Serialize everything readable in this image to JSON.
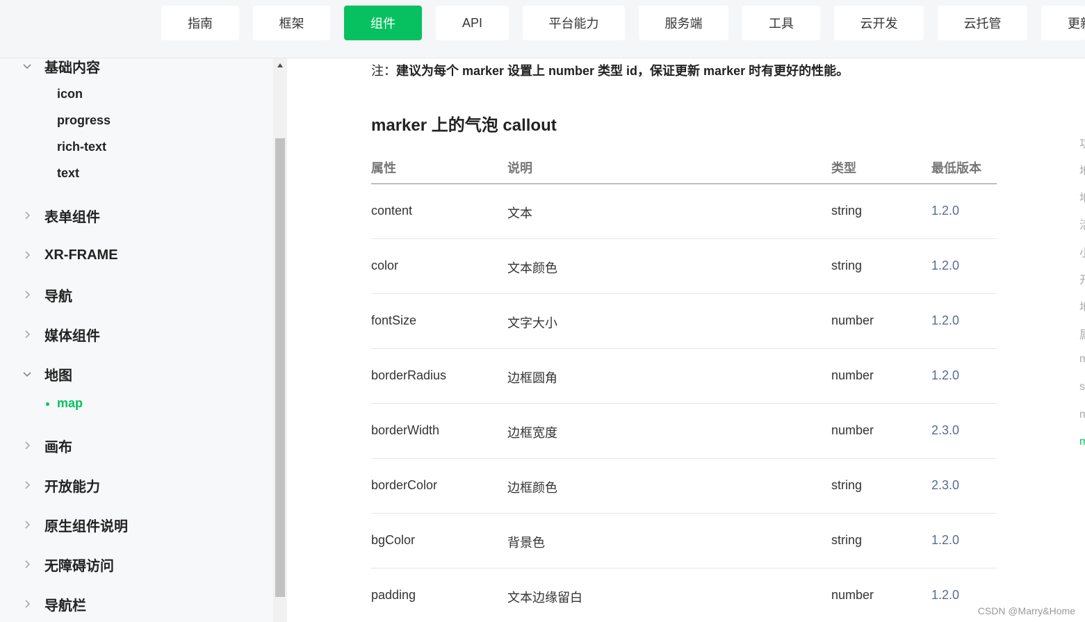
{
  "topnav": {
    "tabs": [
      {
        "label": "指南",
        "active": false
      },
      {
        "label": "框架",
        "active": false
      },
      {
        "label": "组件",
        "active": true
      },
      {
        "label": "API",
        "active": false
      },
      {
        "label": "平台能力",
        "active": false
      },
      {
        "label": "服务端",
        "active": false
      },
      {
        "label": "工具",
        "active": false
      },
      {
        "label": "云开发",
        "active": false
      },
      {
        "label": "云托管",
        "active": false
      },
      {
        "label": "更新",
        "active": false
      }
    ]
  },
  "sidebar": {
    "groups": [
      {
        "label": "基础内容",
        "expanded": true
      },
      {
        "label": "表单组件",
        "expanded": false
      },
      {
        "label": "XR-FRAME",
        "expanded": false
      },
      {
        "label": "导航",
        "expanded": false
      },
      {
        "label": "媒体组件",
        "expanded": false
      },
      {
        "label": "地图",
        "expanded": true
      },
      {
        "label": "画布",
        "expanded": false
      },
      {
        "label": "开放能力",
        "expanded": false
      },
      {
        "label": "原生组件说明",
        "expanded": false
      },
      {
        "label": "无障碍访问",
        "expanded": false
      },
      {
        "label": "导航栏",
        "expanded": false
      }
    ],
    "basic_items": [
      "icon",
      "progress",
      "rich-text",
      "text"
    ],
    "map_items": [
      "map"
    ]
  },
  "content": {
    "note_prefix": "注：",
    "note_text": "建议为每个 marker 设置上 number 类型 id，保证更新 marker 时有更好的性能。",
    "section_title": "marker 上的气泡 callout",
    "table": {
      "headers": [
        "属性",
        "说明",
        "类型",
        "最低版本"
      ],
      "rows": [
        [
          "content",
          "文本",
          "string",
          "1.2.0"
        ],
        [
          "color",
          "文本颜色",
          "string",
          "1.2.0"
        ],
        [
          "fontSize",
          "文字大小",
          "number",
          "1.2.0"
        ],
        [
          "borderRadius",
          "边框圆角",
          "number",
          "1.2.0"
        ],
        [
          "borderWidth",
          "边框宽度",
          "number",
          "2.3.0"
        ],
        [
          "borderColor",
          "边框颜色",
          "string",
          "2.3.0"
        ],
        [
          "bgColor",
          "背景色",
          "string",
          "1.2.0"
        ],
        [
          "padding",
          "文本边缘留白",
          "number",
          "1.2.0"
        ]
      ]
    }
  },
  "toc_stubs": [
    "功",
    "地",
    "地",
    "活",
    "小",
    "开",
    "地",
    "属",
    "m",
    "s",
    "m",
    "m"
  ],
  "watermark": "CSDN @Marry&Home",
  "colors": {
    "accent": "#07c160",
    "link": "#576b95"
  }
}
